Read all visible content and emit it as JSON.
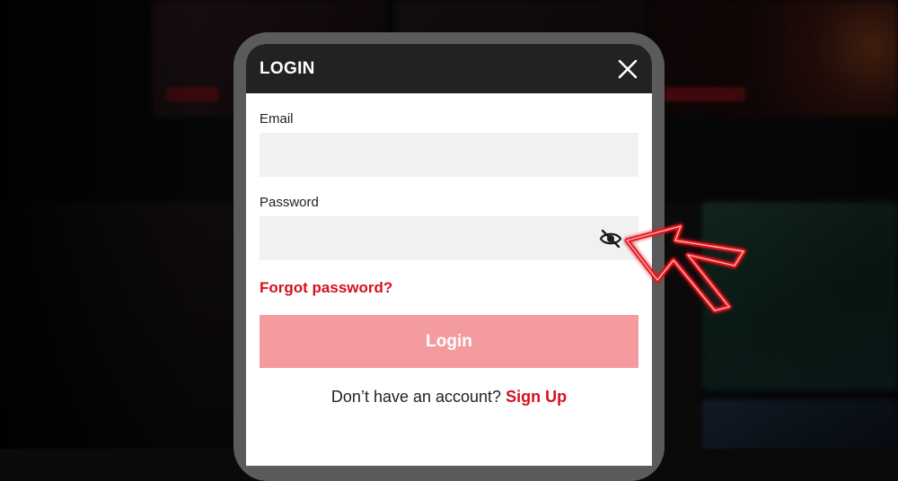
{
  "modal": {
    "title": "LOGIN",
    "close_icon": "close-icon"
  },
  "form": {
    "email_label": "Email",
    "email_value": "",
    "password_label": "Password",
    "password_value": "",
    "password_toggle_icon": "eye-slash-icon",
    "forgot_label": "Forgot password?",
    "login_label": "Login",
    "signup_prompt": "Don’t have an account?",
    "signup_label": "Sign Up"
  },
  "annotation": {
    "arrow_icon": "pointer-arrow-icon",
    "arrow_color": "#e0141f"
  },
  "colors": {
    "accent": "#d4111e",
    "login_button_bg": "#f49ba0",
    "header_bg": "#222222",
    "input_bg": "#f1f1f2",
    "frame": "#5b5b5b"
  }
}
